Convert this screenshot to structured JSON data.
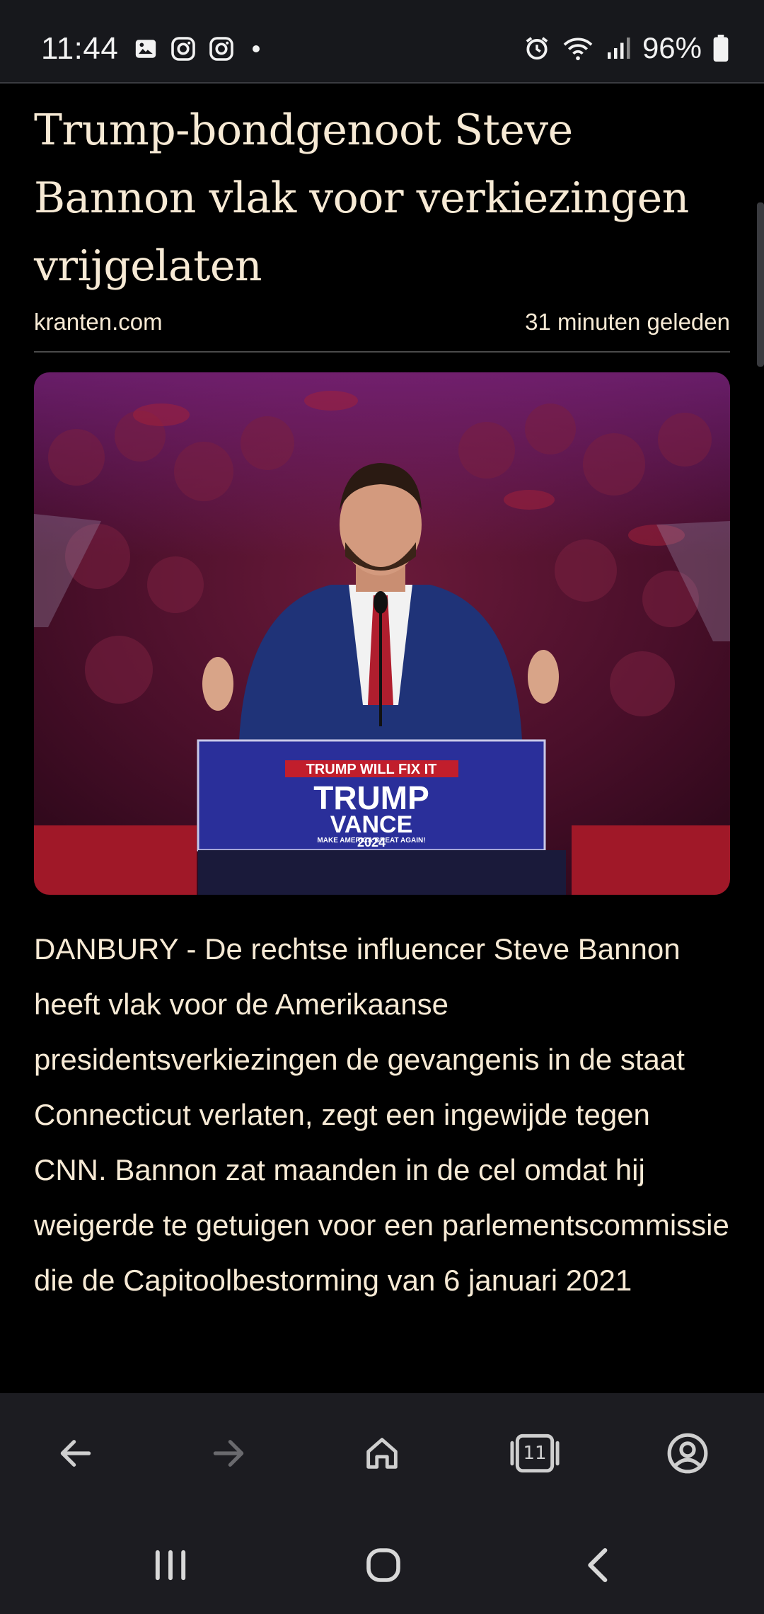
{
  "status_bar": {
    "time": "11:44",
    "battery": "96%",
    "left_icons": [
      "gallery-icon",
      "instagram-icon",
      "instagram-icon",
      "dot-icon"
    ],
    "right_icons": [
      "alarm-icon",
      "wifi-icon",
      "signal-icon",
      "battery-icon"
    ]
  },
  "article": {
    "headline": "Trump-bondgenoot Steve Bannon vlak voor verkiezingen vrijgelaten",
    "source": "kranten.com",
    "time_ago": "31 minuten geleden",
    "photo": {
      "sign_top": "TRUMP WILL FIX IT",
      "sign_line1": "TRUMP",
      "sign_line2": "VANCE",
      "sign_small": "MAKE AMERICA GREAT AGAIN!",
      "sign_year": "2024"
    },
    "body": "DANBURY - De rechtse influencer Steve Bannon heeft vlak voor de Amerikaanse presidentsverkiezingen de gevangenis in de staat Connecticut verlaten, zegt een ingewijde tegen CNN. Bannon zat maanden in de cel omdat hij weigerde te getuigen voor een parlementscommissie die de Capitoolbestorming van 6 januari 2021"
  },
  "toolbar": {
    "tab_count": "11",
    "buttons": [
      "back-icon",
      "forward-icon",
      "home-icon",
      "tabs-icon",
      "account-icon"
    ]
  },
  "navbar": {
    "buttons": [
      "recents-icon",
      "home-nav-icon",
      "back-nav-icon"
    ]
  },
  "colors": {
    "text": "#f7ead5",
    "background": "#000000",
    "bar_background": "#1c1c21"
  }
}
